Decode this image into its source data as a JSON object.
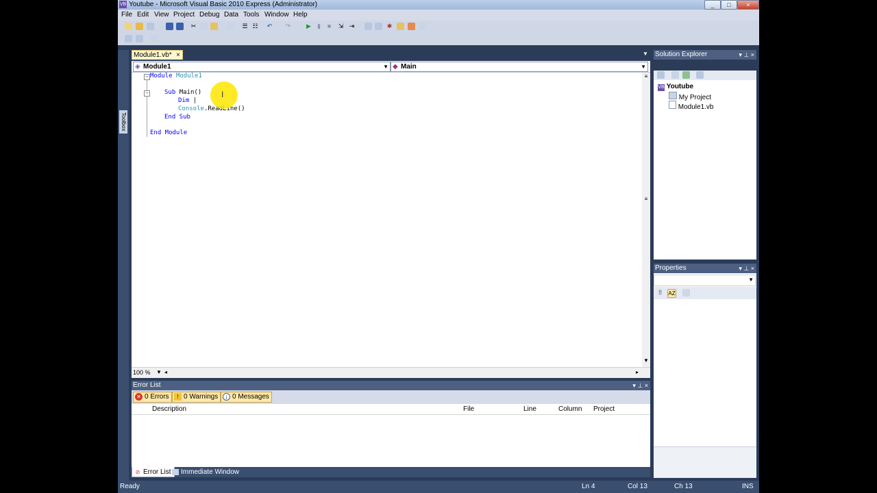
{
  "window": {
    "title": "Youtube - Microsoft Visual Basic 2010 Express (Administrator)",
    "app_icon": "VB",
    "controls": {
      "minimize": "_",
      "maximize": "□",
      "close": "×"
    }
  },
  "menu": [
    "File",
    "Edit",
    "View",
    "Project",
    "Debug",
    "Data",
    "Tools",
    "Window",
    "Help"
  ],
  "colors": {
    "accent": "#4d6082",
    "keyword": "#0000ff",
    "type": "#2b91af",
    "highlight": "#ffe600"
  },
  "toolbox_label": "Toolbox",
  "document_tab": {
    "label": "Module1.vb*",
    "close": "×"
  },
  "editor": {
    "type_dropdown": "Module1",
    "member_dropdown": "Main",
    "zoom": "100 %",
    "code": {
      "l1_kw": "Module",
      "l1_name": "Module1",
      "l2_kw": "Sub",
      "l2_name": "Main()",
      "l3_kw": "Dim",
      "l4_obj": "Console",
      "l4_member": ".ReadLine()",
      "l5_kw": "End Sub",
      "l6_kw": "End Module"
    }
  },
  "solution_explorer": {
    "title": "Solution Explorer",
    "items": [
      "Youtube",
      "My Project",
      "Module1.vb"
    ]
  },
  "properties": {
    "title": "Properties"
  },
  "error_list": {
    "title": "Error List",
    "errors": "0 Errors",
    "warnings": "0 Warnings",
    "messages": "0 Messages",
    "columns": [
      "Description",
      "File",
      "Line",
      "Column",
      "Project"
    ]
  },
  "bottom_tabs": [
    "Error List",
    "Immediate Window"
  ],
  "status": {
    "left": "Ready",
    "ln": "Ln 4",
    "col": "Col 13",
    "ch": "Ch 13",
    "mode": "INS"
  }
}
